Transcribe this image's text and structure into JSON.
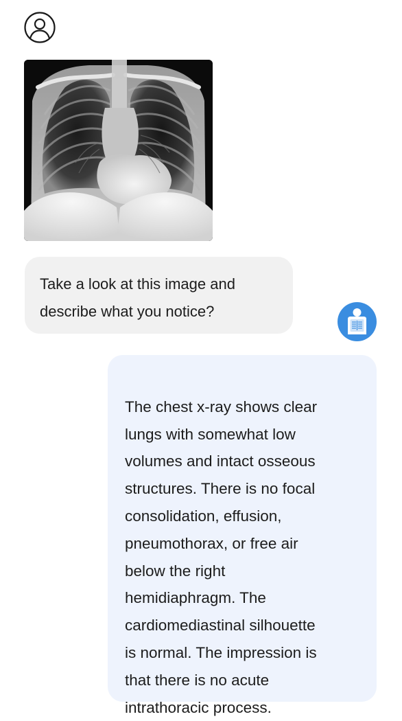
{
  "conversation": {
    "user_message": {
      "text": "Take a look at this image and describe what you notice?",
      "attachment_icon": "chest-xray-image"
    },
    "assistant_message": {
      "text": "The chest x-ray shows clear\nlungs with somewhat low\nvolumes and intact osseous\nstructures. There is no focal\nconsolidation, effusion,\npneumothorax, or free air\nbelow the right\nhemidiaphragm. The\ncardiomediastinal silhouette\nis normal. The impression is\nthat there is no acute\nintrathoracic process."
    }
  },
  "icons": {
    "user_avatar": "person-outline-icon",
    "assistant_avatar": "radiology-report-icon"
  },
  "colors": {
    "user_bubble_bg": "#f1f1f1",
    "assistant_bubble_bg": "#eef3fd",
    "assistant_avatar_bg": "#3a8de0",
    "text": "#1c1c1c"
  }
}
